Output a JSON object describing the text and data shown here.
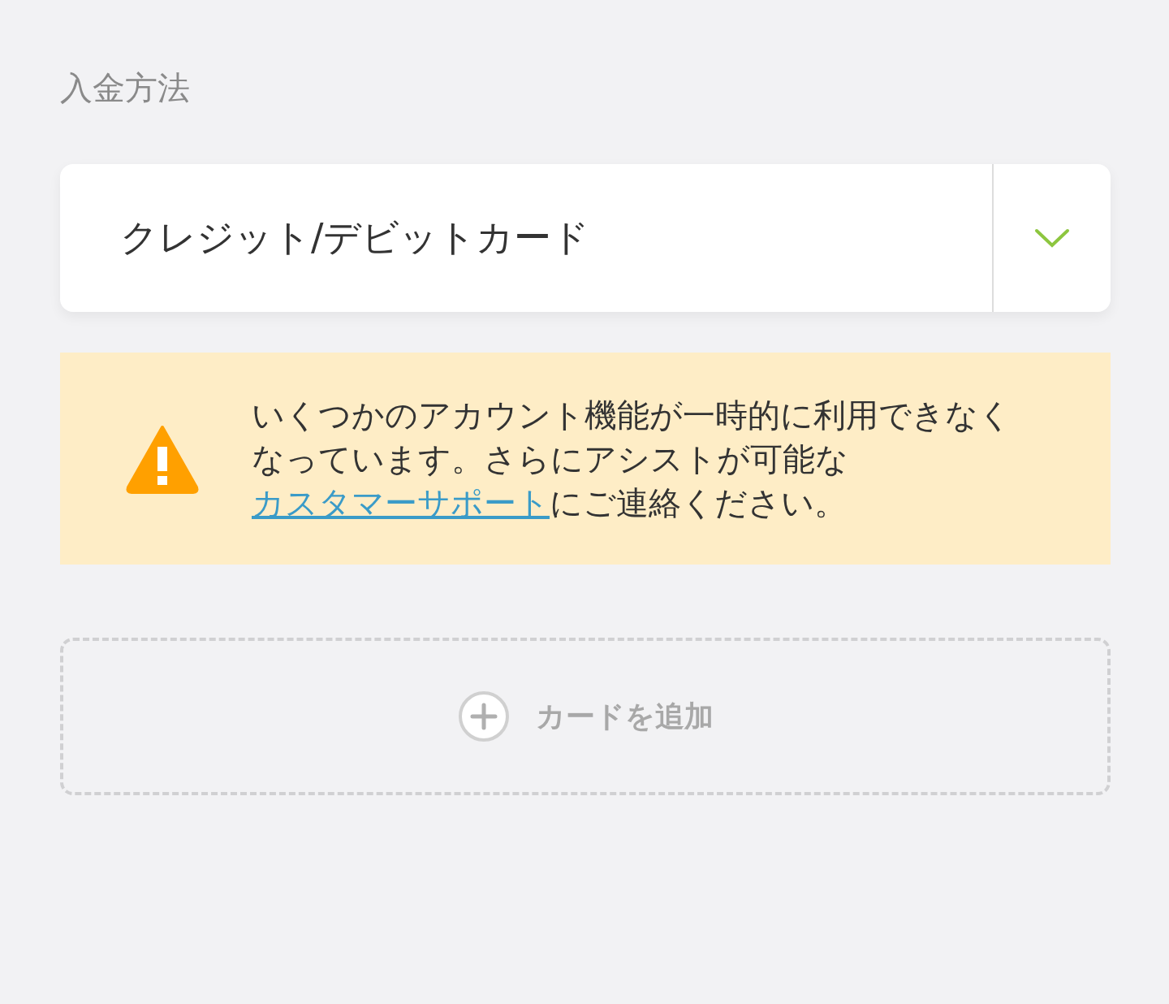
{
  "section_label": "入金方法",
  "method_select": {
    "value": "クレジット/デビットカード"
  },
  "warning": {
    "text_before": "いくつかのアカウント機能が一時的に利用できなくなっています。さらにアシストが可能な",
    "link": "カスタマーサポート",
    "text_after": "にご連絡ください。"
  },
  "add_card": {
    "label": "カードを追加"
  }
}
